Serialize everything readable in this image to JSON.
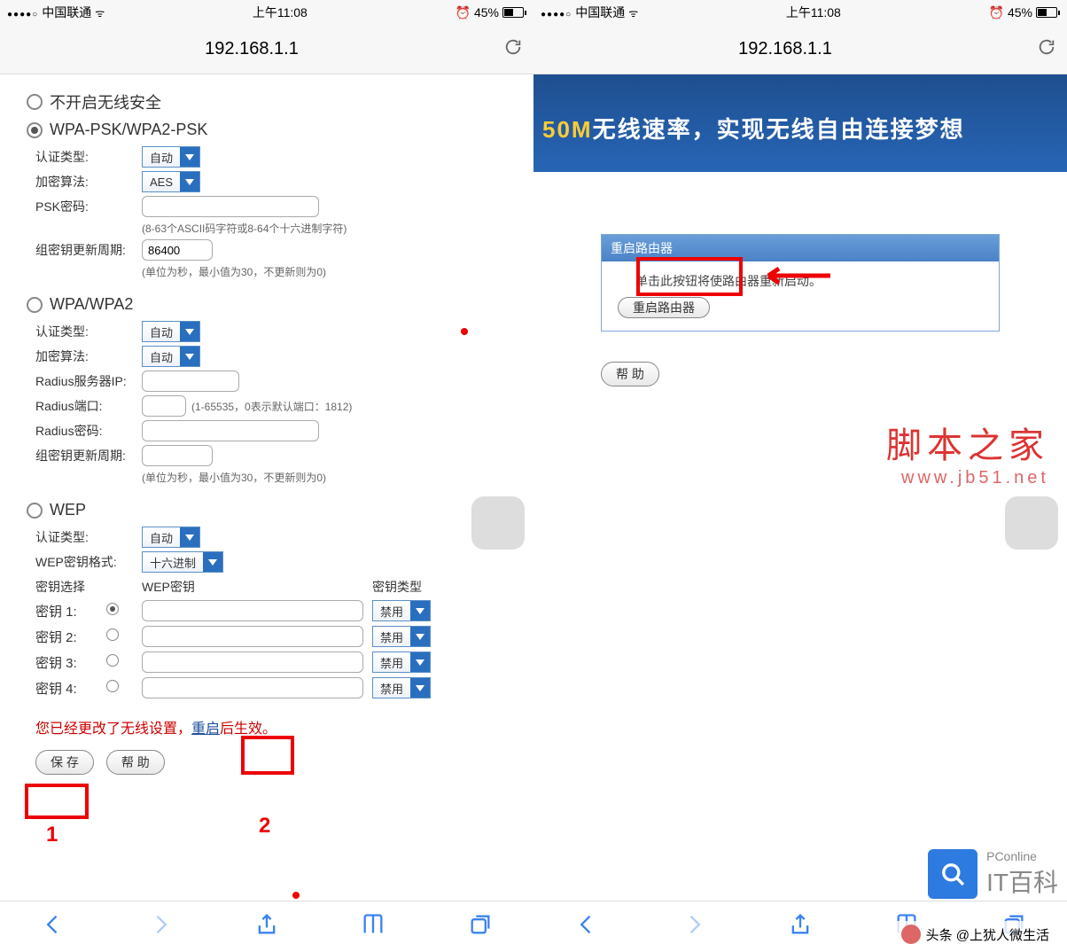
{
  "status": {
    "carrier": "中国联通",
    "time": "上午11:08",
    "alarm_icon": "⏰",
    "battery_pct": "45%"
  },
  "addr": {
    "url": "192.168.1.1"
  },
  "left": {
    "opt0": "不开启无线安全",
    "opt1": "WPA-PSK/WPA2-PSK",
    "auth_label": "认证类型:",
    "auth_val": "自动",
    "enc_label": "加密算法:",
    "enc_val": "AES",
    "psk_label": "PSK密码:",
    "psk_val": "",
    "psk_hint": "(8-63个ASCII码字符或8-64个十六进制字符)",
    "gk_label": "组密钥更新周期:",
    "gk_val": "86400",
    "gk_hint": "(单位为秒，最小值为30，不更新则为0)",
    "opt2": "WPA/WPA2",
    "auto": "自动",
    "radius_ip_label": "Radius服务器IP:",
    "radius_port_label": "Radius端口:",
    "radius_port_hint": "(1-65535，0表示默认端口：1812)",
    "radius_pwd_label": "Radius密码:",
    "gk2_hint": "(单位为秒，最小值为30，不更新则为0)",
    "opt3": "WEP",
    "wep_fmt_label": "WEP密钥格式:",
    "wep_fmt_val": "十六进制",
    "key_select_label": "密钥选择",
    "wep_key_label": "WEP密钥",
    "key_type_label": "密钥类型",
    "key1": "密钥 1:",
    "key2": "密钥 2:",
    "key3": "密钥 3:",
    "key4": "密钥 4:",
    "disabled": "禁用",
    "warn_pre": "您已经更改了无线设置，",
    "warn_link": "重启",
    "warn_post": "后生效。",
    "save_btn": "保 存",
    "help_btn": "帮 助",
    "marker1": "1",
    "marker2": "2"
  },
  "right": {
    "banner_50m": "50M",
    "banner_rest": "无线速率，实现无线自由连接梦想",
    "panel_title": "重启路由器",
    "panel_hint": "单击此按钮将使路由器重新启动。",
    "reboot_btn": "重启路由器",
    "help_btn": "帮 助",
    "wm_line1": "脚本之家",
    "wm_line2": "www.jb51.net",
    "brand_p1": "PConline",
    "brand_p2": "IT百科",
    "footer": "头条 @上犹人微生活"
  }
}
